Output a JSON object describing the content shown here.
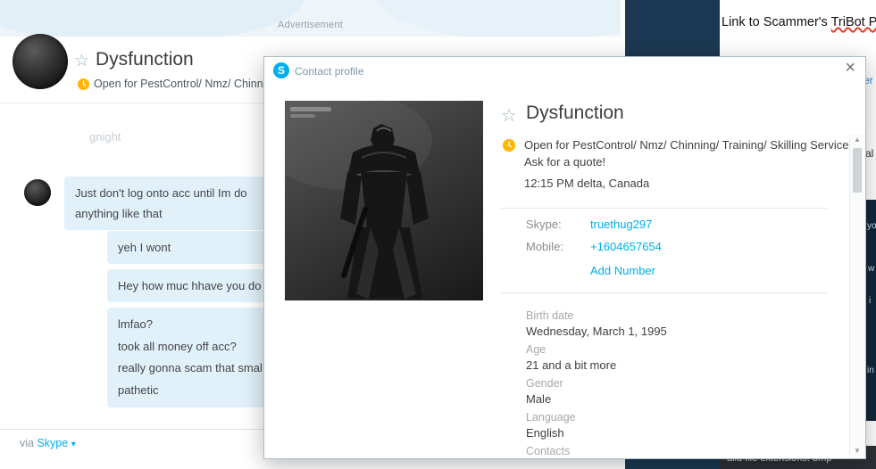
{
  "ad": {
    "label": "Advertisement"
  },
  "chat": {
    "header": {
      "name": "Dysfunction",
      "status": "Open for PestControl/ Nmz/ Chinn",
      "star_icon": "☆"
    },
    "faded_message": "gnight",
    "messages": [
      {
        "direction": "received",
        "lines": [
          "Just don't log onto acc until Im do",
          "anything like that"
        ]
      },
      {
        "direction": "sent",
        "lines": [
          "yeh I wont"
        ]
      },
      {
        "direction": "sent",
        "lines": [
          "Hey how muc hhave you do"
        ]
      },
      {
        "direction": "sent",
        "lines": [
          "lmfao?",
          "took all money off acc?",
          "really gonna scam that smal",
          "pathetic"
        ]
      }
    ],
    "via_prefix": "via",
    "via_link": "Skype",
    "caret_down_icon": "▾"
  },
  "dialog": {
    "title": "Contact profile",
    "skype_logo_letter": "S",
    "close_icon": "×",
    "star_icon": "☆",
    "name": "Dysfunction",
    "mood": "Open for PestControl/ Nmz/ Chinning/ Training/ Skilling Service- Ask for a quote!",
    "local_time": "12:15 PM delta, Canada",
    "contact_rows": [
      {
        "label": "Skype:",
        "value": "truethug297"
      },
      {
        "label": "Mobile:",
        "value": "+1604657654"
      }
    ],
    "add_number_label": "Add Number",
    "detail_fields": [
      {
        "label": "Birth date",
        "value": "Wednesday, March 1, 1995"
      },
      {
        "label": "Age",
        "value": "21 and a bit more"
      },
      {
        "label": "Gender",
        "value": "Male"
      },
      {
        "label": "Language",
        "value": "English"
      },
      {
        "label": "Contacts",
        "value": ""
      }
    ],
    "scroll_up_icon": "▲",
    "scroll_down_icon": "▼"
  },
  "right_window": {
    "heading_prefix": "Link to Scammer's ",
    "heading_flagged": "TriBot P",
    "edge_fragments": [
      "er",
      "al",
      "yo",
      "w",
      "i",
      "in"
    ],
    "bottom_bar_text": "alid file extensions: bmp"
  },
  "colors": {
    "skype_blue": "#00aff0",
    "away_yellow": "#ffb400",
    "bubble_blue": "#e1f1fa",
    "navy_panel": "#1c3852"
  }
}
